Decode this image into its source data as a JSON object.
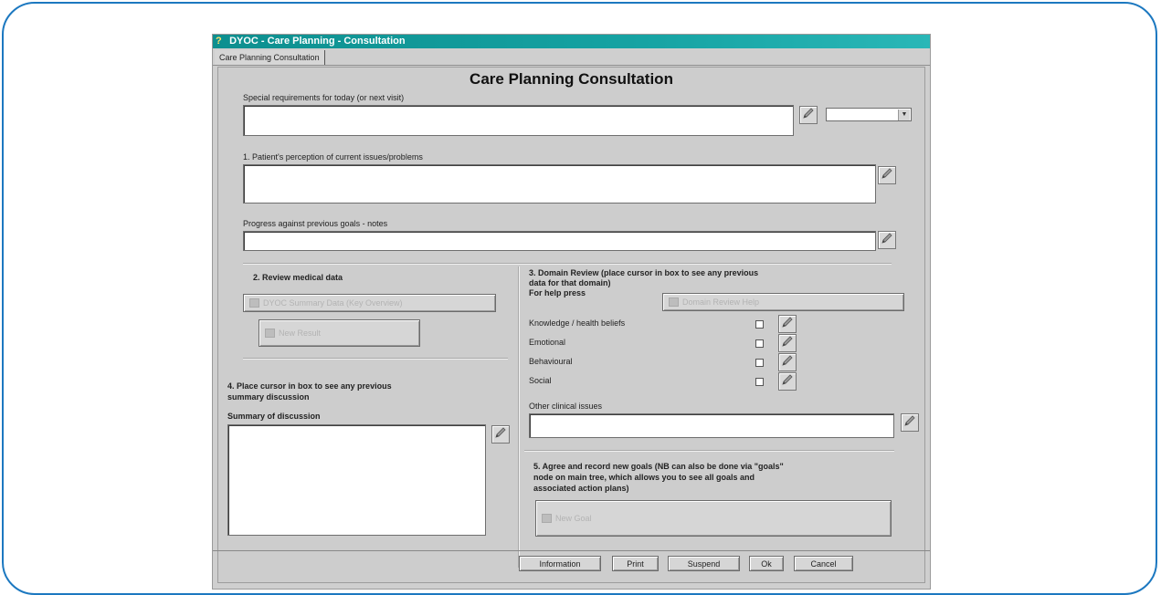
{
  "window": {
    "title": "DYOC - Care Planning - Consultation",
    "tab_label": "Care Planning Consultation"
  },
  "form": {
    "heading": "Care Planning Consultation",
    "special_requirements_label": "Special requirements for today (or next visit)",
    "special_requirements_value": "",
    "special_requirements_select_value": "",
    "patient_perception_label": "1. Patient's perception of current issues/problems",
    "patient_perception_value": "",
    "progress_label": "Progress against previous goals - notes",
    "progress_value": ""
  },
  "review_medical": {
    "heading": "2. Review medical data",
    "summary_button": "DYOC Summary Data (Key Overview)",
    "new_result_button": "New Result"
  },
  "domain_review": {
    "heading_line1": "3. Domain Review (place cursor in box to see any previous",
    "heading_line2": "data for that domain)",
    "help_label": "For help press",
    "help_button": "Domain Review Help",
    "items": [
      {
        "label": "Knowledge / health beliefs",
        "checked": false
      },
      {
        "label": "Emotional",
        "checked": false
      },
      {
        "label": "Behavioural",
        "checked": false
      },
      {
        "label": "Social",
        "checked": false
      }
    ],
    "other_clinical_label": "Other clinical issues",
    "other_clinical_value": ""
  },
  "summary": {
    "instruction_line1": "4. Place cursor in box to see any previous",
    "instruction_line2": "summary discussion",
    "label": "Summary of discussion",
    "value": ""
  },
  "goals": {
    "text_line1": "5. Agree and record new goals (NB can also be done via \"goals\"",
    "text_line2": "node on main tree, which allows you to see all goals and",
    "text_line3": "associated action plans)",
    "new_goal_button": "New Goal"
  },
  "footer": {
    "information": "Information",
    "print": "Print",
    "suspend": "Suspend",
    "ok": "Ok",
    "cancel": "Cancel"
  },
  "colors": {
    "titlebar": "#16a3a3",
    "frame_border": "#1c78c0",
    "window_bg": "#cfcfcf"
  }
}
